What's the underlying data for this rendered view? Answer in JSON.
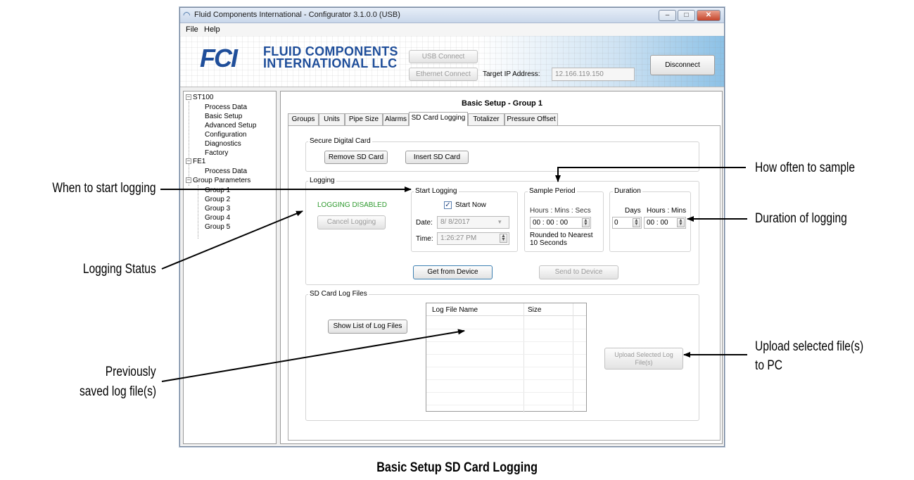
{
  "window": {
    "title": "Fluid Components International - Configurator 3.1.0.0 (USB)",
    "minimize": "–",
    "maximize": "□",
    "close": "✕"
  },
  "menu": [
    "File",
    "Help"
  ],
  "header": {
    "logo_mark": "FCI",
    "logo_line1": "FLUID COMPONENTS",
    "logo_line2": "INTERNATIONAL LLC",
    "usb_connect": "USB Connect",
    "ethernet_connect": "Ethernet Connect",
    "target_ip_label": "Target IP Address:",
    "target_ip_value": "12.166.119.150",
    "disconnect": "Disconnect"
  },
  "tree": {
    "st100": "ST100",
    "st100_items": [
      "Process Data",
      "Basic Setup",
      "Advanced Setup",
      "Configuration",
      "Diagnostics",
      "Factory"
    ],
    "fe1": "FE1",
    "fe1_items": [
      "Process Data"
    ],
    "group_parameters": "Group Parameters",
    "group_items": [
      "Group 1",
      "Group 2",
      "Group 3",
      "Group 4",
      "Group 5"
    ]
  },
  "main": {
    "title": "Basic Setup - Group 1",
    "tabs": [
      "Groups",
      "Units",
      "Pipe Size",
      "Alarms",
      "SD Card Logging",
      "Totalizer",
      "Pressure Offset"
    ],
    "active_tab": "SD Card Logging",
    "sd_card": {
      "label": "Secure Digital Card",
      "remove": "Remove SD Card",
      "insert": "Insert SD Card"
    },
    "logging": {
      "label": "Logging",
      "status": "LOGGING DISABLED",
      "status_color": "#2e9a2e",
      "cancel": "Cancel Logging",
      "start_logging_label": "Start Logging",
      "start_now": "Start Now",
      "start_now_checked": true,
      "date_label": "Date:",
      "date_value": "8/ 8/2017",
      "time_label": "Time:",
      "time_value": "1:26:27 PM",
      "sample_period_label": "Sample Period",
      "sample_units": "Hours : Mins : Secs",
      "sample_value": "00 : 00 : 00",
      "rounded_note": "Rounded to Nearest 10 Seconds",
      "duration_label": "Duration",
      "days_label": "Days",
      "hours_mins_label": "Hours : Mins",
      "days_value": "0",
      "duration_value": "00 : 00",
      "get_from_device": "Get from Device",
      "send_to_device": "Send to Device"
    },
    "log_files": {
      "label": "SD Card Log Files",
      "show_list": "Show List of Log Files",
      "col_name": "Log File Name",
      "col_size": "Size",
      "upload": "Upload Selected Log File(s)"
    }
  },
  "annotations": {
    "when_to_start": "When to start logging",
    "logging_status": "Logging Status",
    "previously_saved_1": "Previously",
    "previously_saved_2": "saved log file(s)",
    "how_often": "How often to sample",
    "duration": "Duration of logging",
    "upload_1": "Upload selected file(s)",
    "upload_2": "to PC"
  },
  "caption": "Basic Setup SD Card Logging"
}
